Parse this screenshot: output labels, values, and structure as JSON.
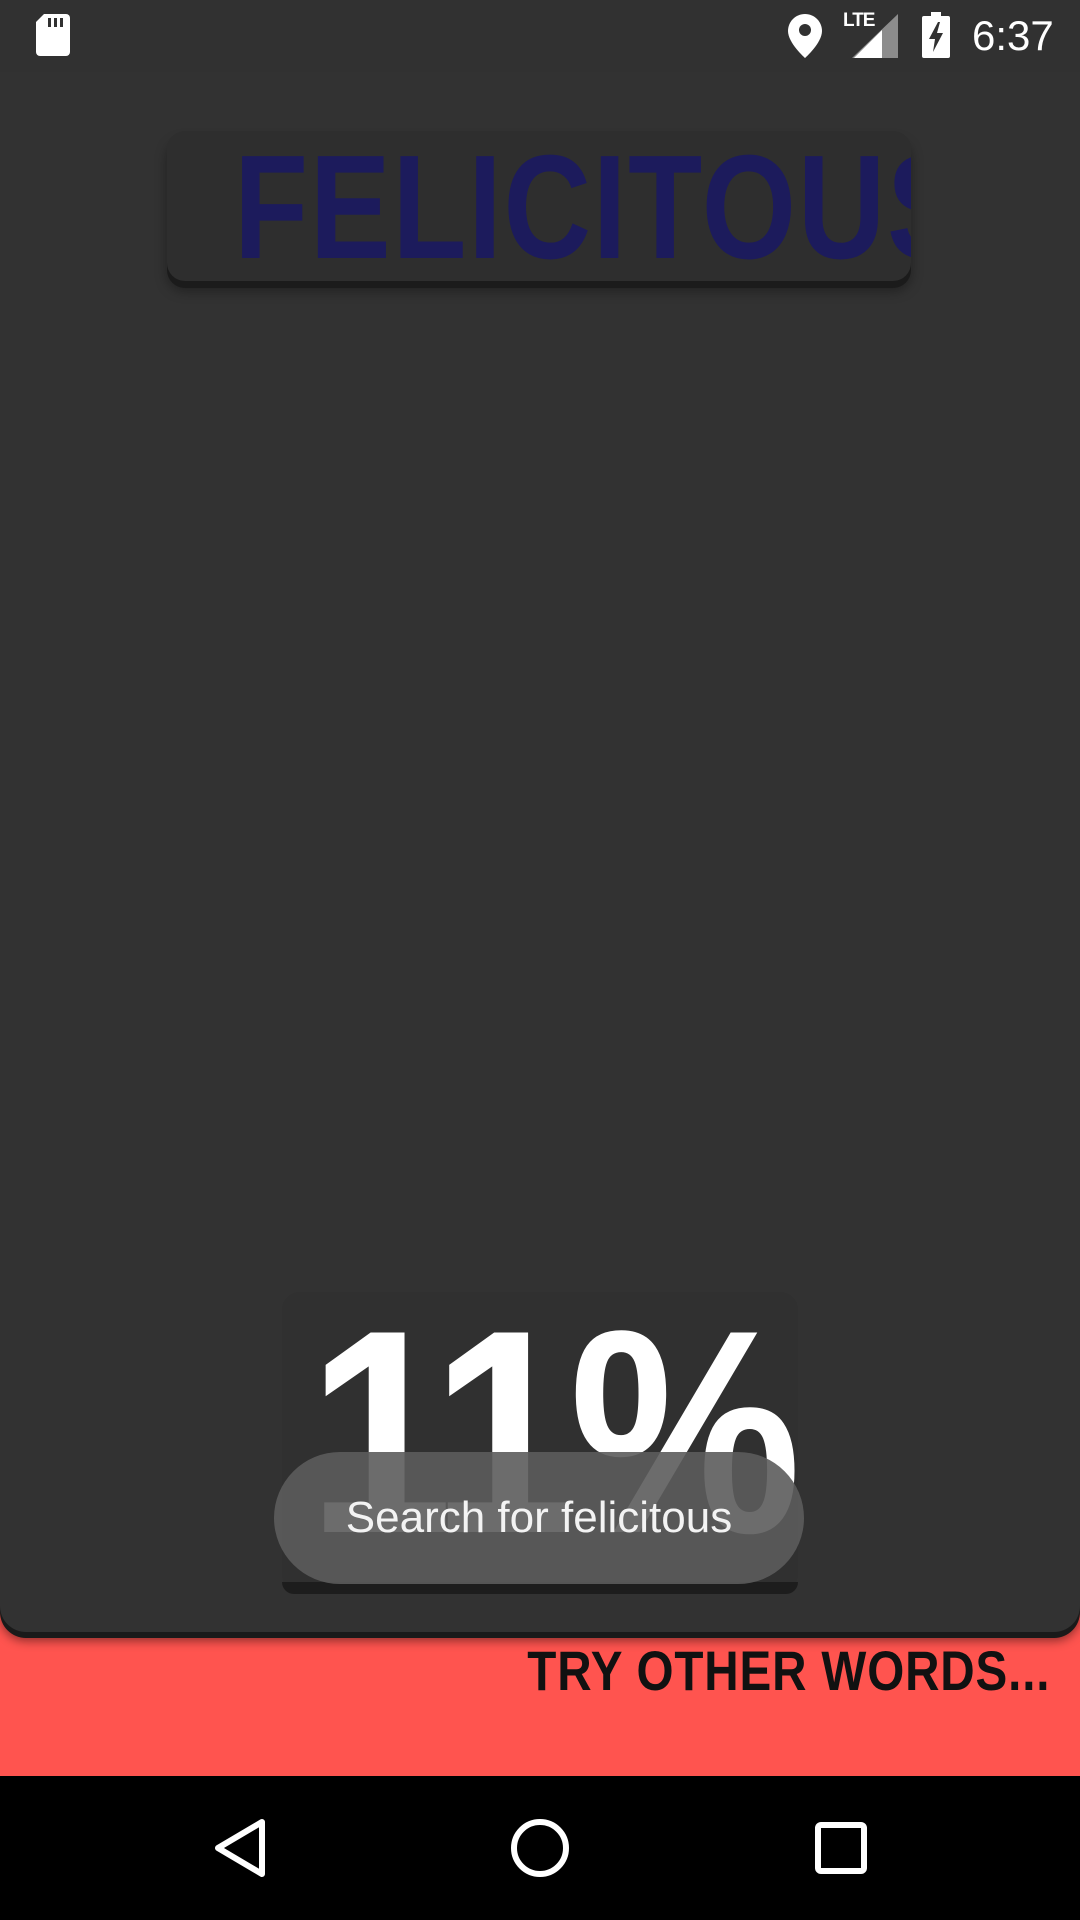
{
  "status_bar": {
    "time": "6:37",
    "network": "LTE",
    "icons": [
      "sd-card-icon",
      "location-pin-icon",
      "signal-icon",
      "battery-charging-icon"
    ]
  },
  "word": {
    "title": "FELICITOUS",
    "title_color": "#1c1b5c"
  },
  "score": {
    "percent_label": "11%"
  },
  "search_toast": {
    "label": "Search for felicitous"
  },
  "footer": {
    "try_other_words": "TRY OTHER WORDS...",
    "accent_color": "#ff544f"
  },
  "nav_bar": {
    "icons": [
      "back-icon",
      "home-icon",
      "recents-icon"
    ]
  }
}
